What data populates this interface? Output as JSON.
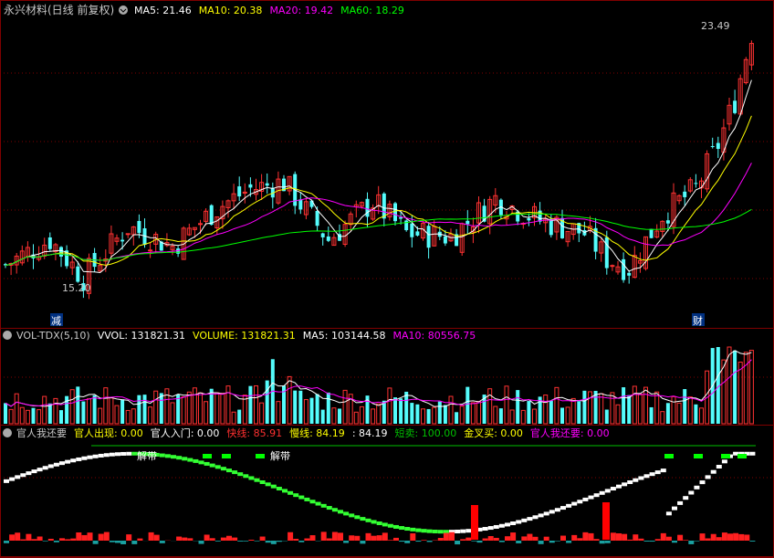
{
  "price_panel": {
    "title": "永兴材料(日线 前复权)",
    "ma_labels": [
      {
        "text": "MA5: 21.46",
        "color": "#ffffff"
      },
      {
        "text": "MA10: 20.38",
        "color": "#ffff00"
      },
      {
        "text": "MA20: 19.42",
        "color": "#ff00ff"
      },
      {
        "text": "MA60: 18.29",
        "color": "#00ff00"
      }
    ],
    "high_label": "23.49",
    "low_label": "15.20",
    "tag_left": "减",
    "tag_right": "财"
  },
  "volume_panel": {
    "labels": [
      {
        "text": "VOL-TDX(5,10)",
        "color": "#c8c8c8"
      },
      {
        "text": "VVOL: 131821.31",
        "color": "#ffffff"
      },
      {
        "text": "VOLUME: 131821.31",
        "color": "#ffff00"
      },
      {
        "text": "MA5: 103144.58",
        "color": "#ffffff"
      },
      {
        "text": "MA10: 80556.75",
        "color": "#ff00ff"
      }
    ]
  },
  "indicator_panel": {
    "labels": [
      {
        "text": "官人我还要",
        "color": "#c8c8c8"
      },
      {
        "text": "官人出现: 0.00",
        "color": "#ffff00"
      },
      {
        "text": "官人入门: 0.00",
        "color": "#ffffff"
      },
      {
        "text": "快线: 85.91",
        "color": "#ff3030"
      },
      {
        "text": "慢线: 84.19",
        "color": "#ffff00"
      },
      {
        "text": ": 84.19",
        "color": "#ffffff"
      },
      {
        "text": "短卖: 100.00",
        "color": "#00c000"
      },
      {
        "text": "金叉买: 0.00",
        "color": "#ffff00"
      },
      {
        "text": "官人我还要: 0.00",
        "color": "#ff00ff"
      }
    ],
    "annotations": [
      "解带",
      "解带"
    ]
  },
  "chart_data": {
    "type": "candlestick",
    "price_range": [
      15.2,
      23.49
    ],
    "colors": {
      "up": "#ff3232",
      "down": "#54fcfc",
      "ma5": "#ffffff",
      "ma10": "#ffff00",
      "ma20": "#ff00ff",
      "ma60": "#00ff00",
      "bg": "#000000",
      "grid": "#7f0000"
    }
  }
}
